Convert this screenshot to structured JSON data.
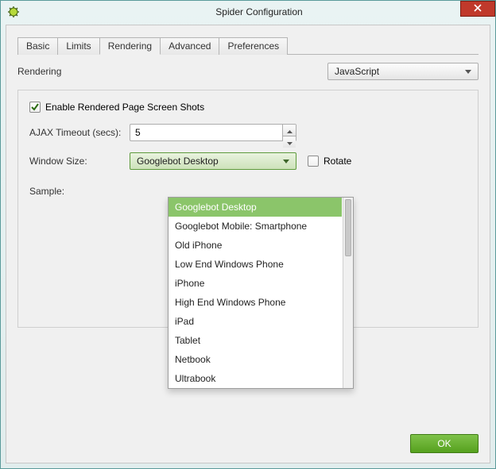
{
  "window": {
    "title": "Spider Configuration"
  },
  "tabs": [
    "Basic",
    "Limits",
    "Rendering",
    "Advanced",
    "Preferences"
  ],
  "active_tab_index": 2,
  "labels": {
    "rendering": "Rendering",
    "enable_screenshots": "Enable Rendered Page Screen Shots",
    "ajax_timeout": "AJAX Timeout (secs):",
    "window_size": "Window Size:",
    "rotate": "Rotate",
    "sample": "Sample:"
  },
  "values": {
    "rendering_mode": "JavaScript",
    "enable_screenshots_checked": true,
    "ajax_timeout": "5",
    "window_size_selected": "Googlebot Desktop",
    "rotate_checked": false
  },
  "window_size_options": [
    "Googlebot Desktop",
    "Googlebot Mobile: Smartphone",
    "Old iPhone",
    "Low End Windows Phone",
    "iPhone",
    "High End Windows Phone",
    "iPad",
    "Tablet",
    "Netbook",
    "Ultrabook"
  ],
  "buttons": {
    "ok": "OK"
  },
  "colors": {
    "accent_green": "#56a11e",
    "close_red": "#c0392b"
  }
}
